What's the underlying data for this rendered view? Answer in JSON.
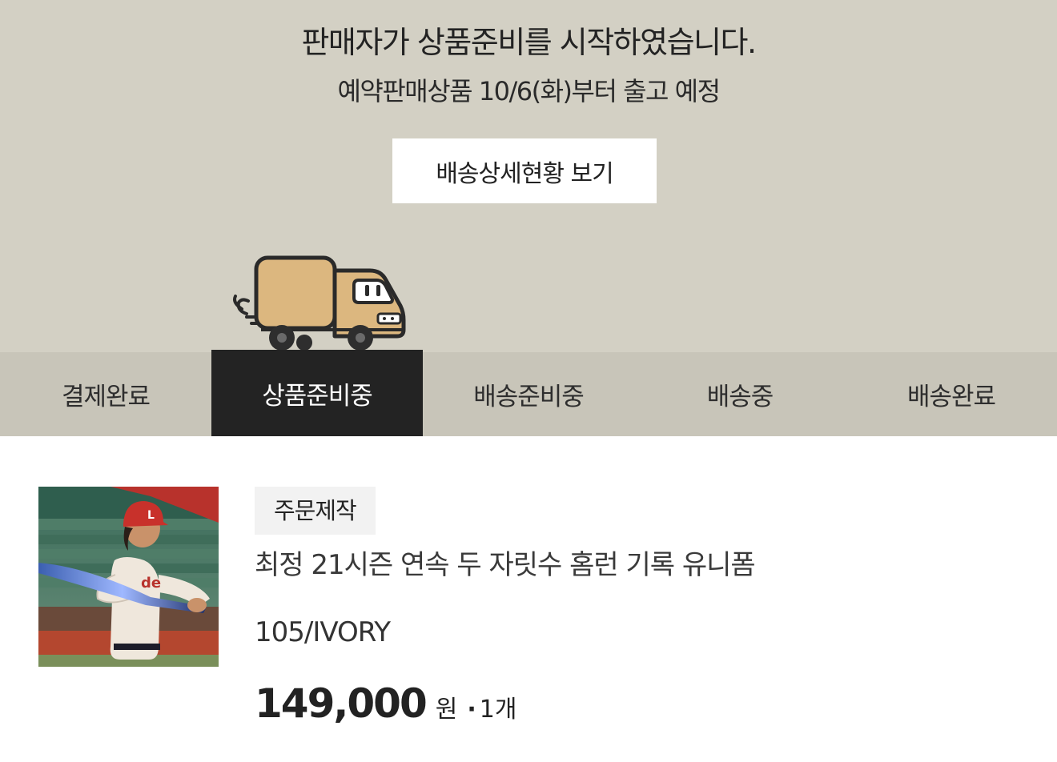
{
  "status": {
    "title": "판매자가 상품준비를 시작하였습니다.",
    "subtitle": "예약판매상품 10/6(화)부터 출고 예정",
    "detail_button": "배송상세현황 보기",
    "illustration_icon": "delivery-truck-icon"
  },
  "steps": [
    {
      "label": "결제완료",
      "active": false
    },
    {
      "label": "상품준비중",
      "active": true
    },
    {
      "label": "배송준비중",
      "active": false
    },
    {
      "label": "배송중",
      "active": false
    },
    {
      "label": "배송완료",
      "active": false
    }
  ],
  "order_item": {
    "badge": "주문제작",
    "name": "최정 21시즌 연속 두 자릿수 홈런 기록 유니폼",
    "option": "105/IVORY",
    "price": "149,000",
    "currency": "원",
    "separator": "·",
    "quantity": "1개"
  },
  "colors": {
    "hero_background": "#d3d0c4",
    "step_bar_background": "#c8c5b9",
    "active_step": "#232323",
    "truck_body": "#dcb77f"
  }
}
